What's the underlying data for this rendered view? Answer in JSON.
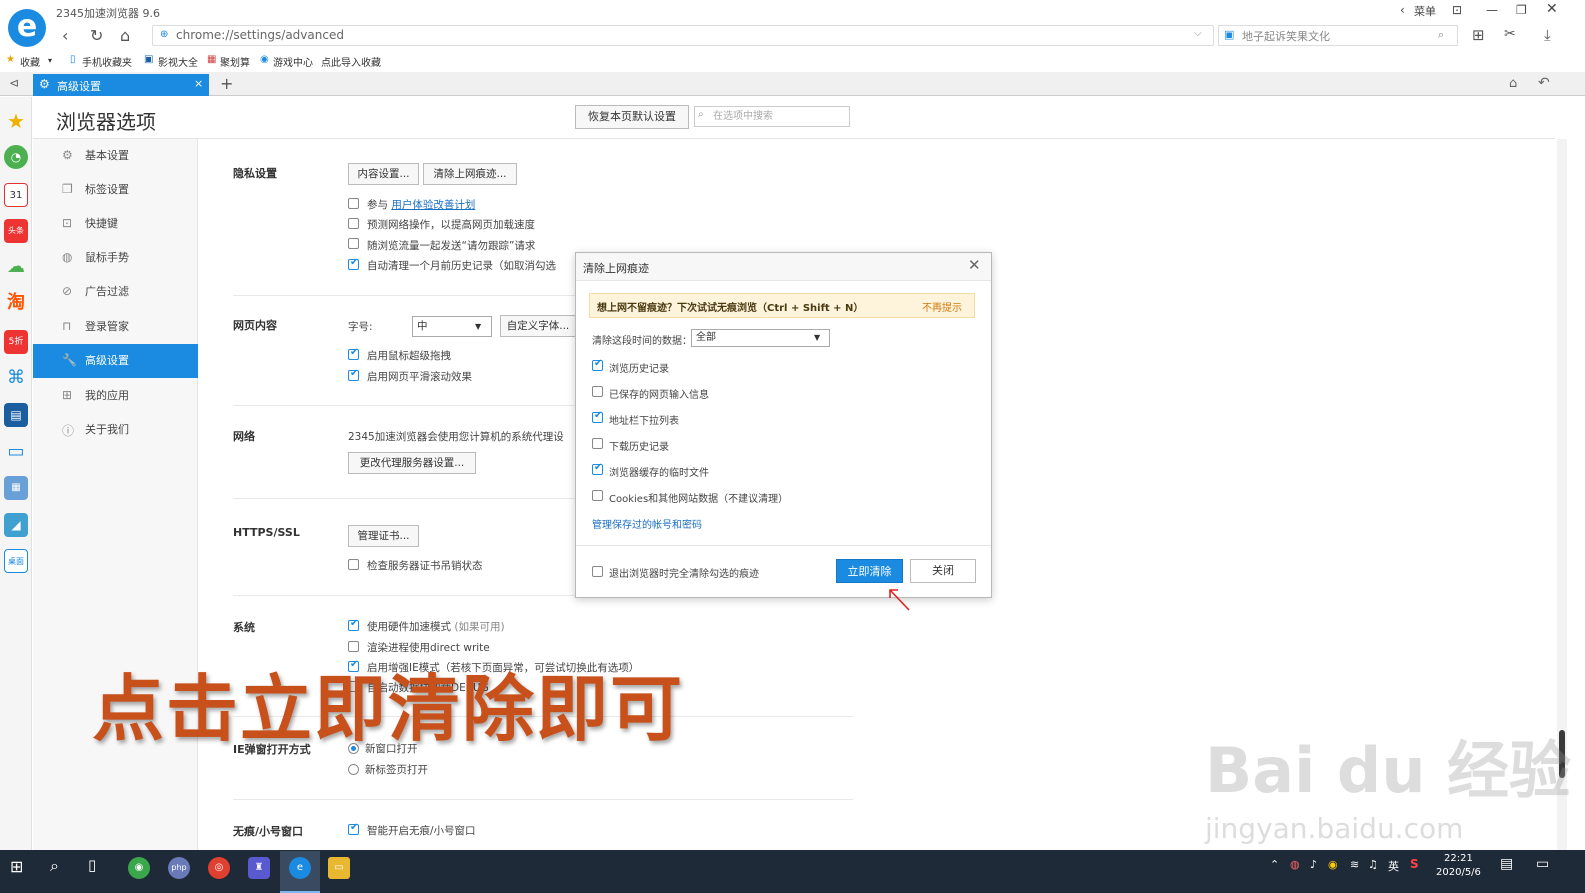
{
  "browser": {
    "app_title": "2345加速浏览器 9.6",
    "menu_label": "菜单",
    "url": "chrome://settings/advanced",
    "search_placeholder": "地子起诉笑果文化",
    "bookmarks": [
      "收藏",
      "手机收藏夹",
      "影视大全",
      "聚划算",
      "游戏中心",
      "点此导入收藏"
    ],
    "tab_label": "高级设置",
    "new_tab_symbol": "+"
  },
  "page": {
    "title": "浏览器选项",
    "restore_button": "恢复本页默认设置",
    "search_placeholder": "在选项中搜索"
  },
  "sidebar": {
    "items": [
      {
        "label": "基本设置",
        "icon": "gear-icon"
      },
      {
        "label": "标签设置",
        "icon": "tab-icon"
      },
      {
        "label": "快捷键",
        "icon": "keyboard-icon"
      },
      {
        "label": "鼠标手势",
        "icon": "mouse-icon"
      },
      {
        "label": "广告过滤",
        "icon": "block-icon"
      },
      {
        "label": "登录管家",
        "icon": "lock-icon"
      },
      {
        "label": "高级设置",
        "icon": "wrench-icon",
        "active": true
      },
      {
        "label": "我的应用",
        "icon": "apps-icon"
      },
      {
        "label": "关于我们",
        "icon": "info-icon"
      }
    ]
  },
  "settings": {
    "privacy": {
      "heading": "隐私设置",
      "content_btn": "内容设置...",
      "clear_btn": "清除上网痕迹...",
      "opt1_prefix": "参与",
      "opt1_link": "用户体验改善计划",
      "opt2": "预测网络操作，以提高网页加载速度",
      "opt3": "随浏览流量一起发送“请勿跟踪”请求",
      "opt4": "自动清理一个月前历史记录（如取消勾选"
    },
    "webcontent": {
      "heading": "网页内容",
      "font_label": "字号:",
      "font_value": "中",
      "custom_font_btn": "自定义字体...",
      "opt1": "启用鼠标超级拖拽",
      "opt2": "启用网页平滑滚动效果"
    },
    "network": {
      "heading": "网络",
      "desc": "2345加速浏览器会使用您计算机的系统代理设",
      "proxy_btn": "更改代理服务器设置..."
    },
    "https": {
      "heading": "HTTPS/SSL",
      "cert_btn": "管理证书...",
      "opt1": "检查服务器证书吊销状态"
    },
    "system": {
      "heading": "系统",
      "opt1": "使用硬件加速模式",
      "opt1_note": "(如果可用)",
      "opt2": "渲染进程使用direct write",
      "opt3": "启用增强IE模式（若核下页面异常，可尝试切换此有选项）",
      "opt4": "自启动数据块加载DEBUG"
    },
    "ie_popup": {
      "heading": "IE弹窗打开方式",
      "opt1": "新窗口打开",
      "opt2": "新标签页打开"
    },
    "incognito": {
      "heading": "无痕/小号窗口",
      "opt1": "智能开启无痕/小号窗口"
    }
  },
  "dialog": {
    "title": "清除上网痕迹",
    "tip": "想上网不留痕迹？下次试试无痕浏览（Ctrl + Shift + N）",
    "tip_dismiss": "不再提示",
    "range_label": "清除这段时间的数据：",
    "range_value": "全部",
    "options": [
      {
        "label": "浏览历史记录",
        "checked": true
      },
      {
        "label": "已保存的网页输入信息",
        "checked": false
      },
      {
        "label": "地址栏下拉列表",
        "checked": true
      },
      {
        "label": "下载历史记录",
        "checked": false
      },
      {
        "label": "浏览器缓存的临时文件",
        "checked": true
      },
      {
        "label": "Cookies和其他网站数据（不建议清理）",
        "checked": false
      }
    ],
    "manage_link": "管理保存过的帐号和密码",
    "exit_clear": "退出浏览器时完全清除勾选的痕迹",
    "clear_btn": "立即清除",
    "close_btn": "关闭"
  },
  "overlay_text": "点击立即清除即可",
  "watermark": {
    "main": "Bai du 经验",
    "sub": "jingyan.baidu.com"
  },
  "taskbar": {
    "time": "22:21",
    "date": "2020/5/6",
    "lang": "英"
  },
  "colors": {
    "accent": "#1a8be0",
    "overlay": "#c8501a"
  }
}
